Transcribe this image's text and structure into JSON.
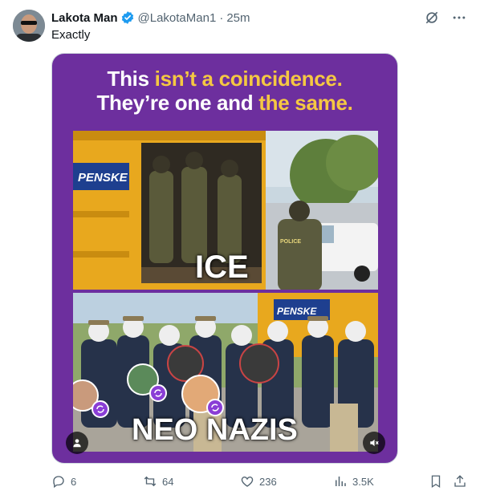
{
  "author": {
    "name": "Lakota Man",
    "handle": "@LakotaMan1",
    "separator": "·",
    "time": "25m"
  },
  "tweet": {
    "text": "Exactly"
  },
  "media": {
    "headline_line1_a": "This ",
    "headline_line1_b": "isn’t a coincidence.",
    "headline_line2_a": "They’re one and ",
    "headline_line2_b": "the same.",
    "label_top": "ICE",
    "label_bottom": "NEO NAZIS",
    "truck_logo_top": "PENSKE",
    "truck_logo_bottom": "PENSKE",
    "police_text": "POLICE",
    "colors": {
      "background": "#6d2f9e",
      "highlight": "#f5c842"
    }
  },
  "actions": {
    "replies": "6",
    "reposts": "64",
    "likes": "236",
    "views": "3.5K"
  },
  "icons": [
    "verified-badge-icon",
    "grok-icon",
    "more-icon",
    "reply-icon",
    "repost-icon",
    "like-icon",
    "views-icon",
    "bookmark-icon",
    "share-icon",
    "person-icon",
    "mute-icon"
  ]
}
